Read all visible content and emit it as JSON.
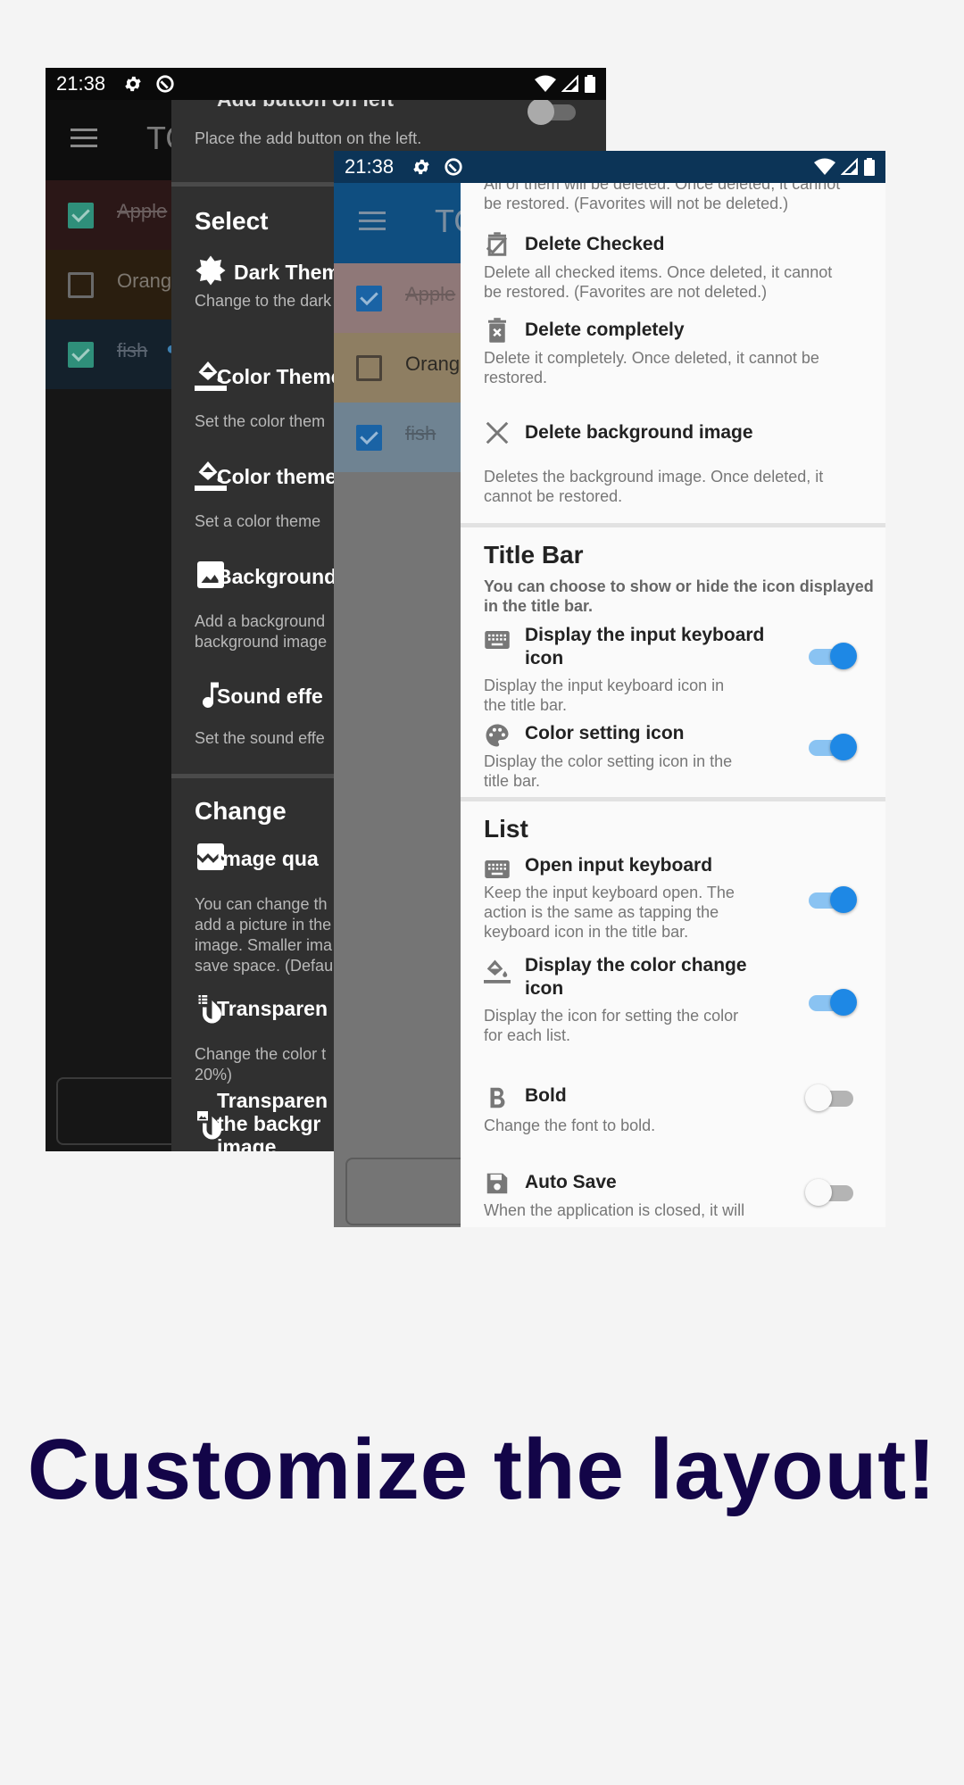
{
  "headline": "Customize the layout!",
  "colors": {
    "headline": "#130548",
    "accent_blue": "#1e88e5",
    "dark_checkbox": "#2f8f7a",
    "blue_statusbar": "#0c3457",
    "blue_appbar": "#0f4e80"
  },
  "back_phone": {
    "status_bar": {
      "time": "21:38",
      "icons": [
        "gear-icon",
        "do-not-disturb-icon",
        "wifi-icon",
        "signal-icon",
        "battery-icon"
      ]
    },
    "app_title": "TO",
    "list": [
      {
        "label": "Apple",
        "checked": true,
        "bg": "#2b1717"
      },
      {
        "label": "Orange",
        "checked": false,
        "bg": "#2a1e0f"
      },
      {
        "label": "fish",
        "checked": true,
        "bg": "#14212c"
      }
    ],
    "settings": {
      "top_item": {
        "title": "Add button on left",
        "desc": "Place the add button on the left.",
        "enabled": false
      },
      "select_section": {
        "header": "Select",
        "items": [
          {
            "icon": "dark-theme-icon",
            "title": "Dark Theme",
            "desc": "Change to the dark"
          },
          {
            "icon": "paint-bucket-icon",
            "title": "Color Theme",
            "desc": "Set the color them"
          },
          {
            "icon": "paint-bucket-icon",
            "title": "Color theme",
            "desc": "Set a color theme"
          },
          {
            "icon": "image-icon",
            "title": "Background",
            "desc": "Add a background\nbackground image"
          },
          {
            "icon": "music-note-icon",
            "title": "Sound effe",
            "desc": "Set the sound effe"
          }
        ]
      },
      "change_section": {
        "header": "Change",
        "items": [
          {
            "icon": "image-quality-icon",
            "title": "Image qua",
            "desc": "You can change th\nadd a picture in the\nimage. Smaller ima\nsave space. (Defau"
          },
          {
            "icon": "transparency-list-icon",
            "title": "Transparen",
            "desc": "Change the color t\n20%)"
          },
          {
            "icon": "transparency-image-icon",
            "title": "Transparen\nthe backgr\nimage",
            "desc": ""
          }
        ]
      }
    }
  },
  "front_phone": {
    "status_bar": {
      "time": "21:38",
      "icons": [
        "gear-icon",
        "do-not-disturb-icon",
        "wifi-icon",
        "signal-icon",
        "battery-icon"
      ]
    },
    "app_title": "TO",
    "list": [
      {
        "label": "Apple",
        "checked": true,
        "bg": "#8f7878"
      },
      {
        "label": "Orange",
        "checked": false,
        "bg": "#8e7e62"
      },
      {
        "label": "fish",
        "checked": true,
        "bg": "#6f8392"
      }
    ],
    "settings": {
      "top_desc": "All of them will be deleted. Once deleted, it cannot\nbe restored. (Favorites will not be deleted.)",
      "delete_items": [
        {
          "icon": "delete-checked-icon",
          "title": "Delete Checked",
          "desc": "Delete all checked items. Once deleted, it cannot\nbe restored. (Favorites are not deleted.)"
        },
        {
          "icon": "delete-forever-icon",
          "title": "Delete completely",
          "desc": "Delete it completely. Once deleted, it cannot be\nrestored."
        },
        {
          "icon": "close-icon",
          "title": "Delete background image",
          "desc": "Deletes the background image. Once deleted, it\ncannot be restored."
        }
      ],
      "title_bar_section": {
        "header": "Title Bar",
        "subtitle": "You can choose to show or hide the icon displayed\nin the title bar.",
        "items": [
          {
            "icon": "keyboard-icon",
            "title": "Display the input keyboard\nicon",
            "desc": "Display the input keyboard icon in\nthe title bar.",
            "enabled": true
          },
          {
            "icon": "palette-icon",
            "title": "Color setting icon",
            "desc": "Display the color setting icon in the\ntitle bar.",
            "enabled": true
          }
        ]
      },
      "list_section": {
        "header": "List",
        "items": [
          {
            "icon": "keyboard-icon",
            "title": "Open input keyboard",
            "desc": "Keep the input keyboard open. The\naction is the same as tapping the\nkeyboard icon in the title bar.",
            "enabled": true
          },
          {
            "icon": "paint-bucket-icon",
            "title": "Display the color change\nicon",
            "desc": "Display the icon for setting the color\nfor each list.",
            "enabled": true
          },
          {
            "icon": "bold-icon",
            "title": "Bold",
            "desc": "Change the font to bold.",
            "enabled": false
          },
          {
            "icon": "save-icon",
            "title": "Auto Save",
            "desc": "When the application is closed, it will",
            "enabled": false
          }
        ]
      }
    }
  }
}
